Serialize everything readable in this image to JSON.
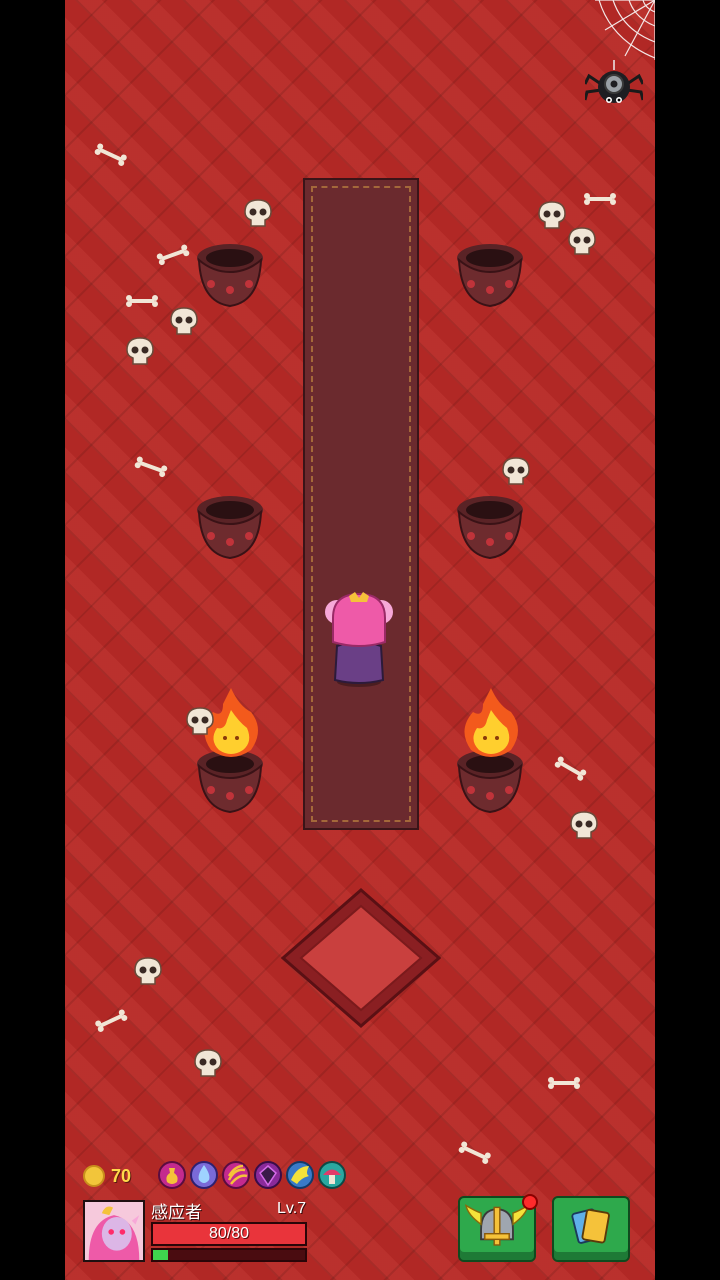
{
  "scene": {
    "name": "dungeon-altar-room",
    "floor_color": "#b82a26",
    "carpet_color": "#6b2a2e",
    "cauldrons": [
      {
        "id": "top-left",
        "lit": false
      },
      {
        "id": "top-right",
        "lit": false
      },
      {
        "id": "mid-left",
        "lit": false
      },
      {
        "id": "mid-right",
        "lit": false
      },
      {
        "id": "bottom-left",
        "lit": true
      },
      {
        "id": "bottom-right",
        "lit": true
      }
    ]
  },
  "hud": {
    "gold": "70",
    "relics": [
      "potion-relic-icon",
      "water-drop-relic-icon",
      "claw-relic-icon",
      "gem-relic-icon",
      "wing-relic-icon",
      "mushroom-relic-icon"
    ],
    "character": {
      "name": "感应者",
      "level": "Lv.7",
      "hp_text": "80/80",
      "hp_fraction": 1.0,
      "xp_fraction": 0.1
    },
    "buttons": {
      "equipment_icon": "winged-helmet-icon",
      "equipment_has_notification": true,
      "cards_icon": "cards-icon"
    },
    "settings_icon": "spider-gear-icon"
  }
}
